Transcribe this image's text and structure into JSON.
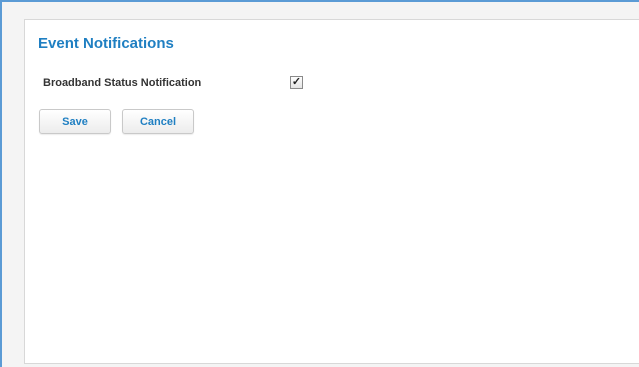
{
  "page": {
    "title": "Event Notifications"
  },
  "settings": {
    "broadband_status": {
      "label": "Broadband Status Notification",
      "checked": true,
      "check_glyph": "✓"
    }
  },
  "actions": {
    "save_label": "Save",
    "cancel_label": "Cancel"
  },
  "colors": {
    "accent": "#1f7fc2",
    "frame_border": "#5b9bd5"
  }
}
